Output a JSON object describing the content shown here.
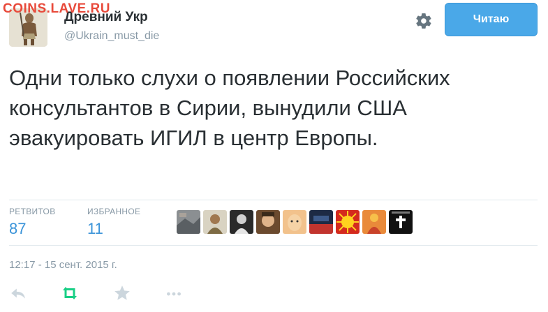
{
  "watermark": "COINS.LAVE.RU",
  "author": {
    "name": "Древний Укр",
    "handle": "@Ukrain_must_die"
  },
  "follow_button": {
    "label": "Читаю"
  },
  "tweet": {
    "text": "Одни только слухи о появлении Российских консультантов в Сирии, вынудили США эвакуировать ИГИЛ в центр Европы."
  },
  "stats": {
    "retweets": {
      "label": "РЕТВИТОВ",
      "value": "87"
    },
    "favorites": {
      "label": "ИЗБРАННОЕ",
      "value": "11"
    }
  },
  "timestamp": "12:17 - 15 сент. 2015 г.",
  "colors": {
    "accent": "#3b94d9",
    "button": "#4aa8e8",
    "retweet_green": "#19cf86",
    "muted": "#8899a6"
  },
  "icons": {
    "settings": "gear-icon",
    "reply": "reply-icon",
    "retweet": "retweet-icon",
    "favorite": "star-icon",
    "more": "more-icon"
  }
}
